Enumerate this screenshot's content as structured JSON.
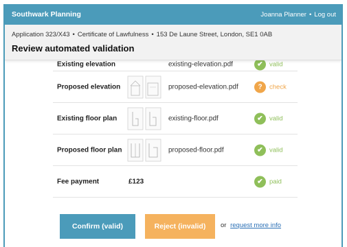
{
  "header": {
    "brand": "Southwark Planning",
    "user_name": "Joanna Planner",
    "separator": "•",
    "logout": "Log out"
  },
  "context": {
    "application": "Application 323/X43",
    "type": "Certificate of Lawfulness",
    "address": "153 De Laune Street, London, SE1 0AB",
    "separator": "•",
    "title": "Review automated validation"
  },
  "rows": [
    {
      "label": "Existing elevation",
      "file": "existing-elevation.pdf",
      "status": "valid",
      "status_label": "valid",
      "status_symbol": "✔"
    },
    {
      "label": "Proposed elevation",
      "file": "proposed-elevation.pdf",
      "status": "check",
      "status_label": "check",
      "status_symbol": "?"
    },
    {
      "label": "Existing floor plan",
      "file": "existing-floor.pdf",
      "status": "valid",
      "status_label": "valid",
      "status_symbol": "✔"
    },
    {
      "label": "Proposed floor plan",
      "file": "proposed-floor.pdf",
      "status": "valid",
      "status_label": "valid",
      "status_symbol": "✔"
    },
    {
      "label": "Fee payment",
      "amount": "£123",
      "status": "valid",
      "status_label": "paid",
      "status_symbol": "✔"
    }
  ],
  "actions": {
    "confirm": "Confirm (valid)",
    "reject": "Reject (invalid)",
    "or": "or",
    "request": "request more info"
  },
  "colors": {
    "brand": "#4b9bba",
    "valid": "#8fbf5a",
    "check": "#f0a64a",
    "reject": "#f5b25e"
  }
}
